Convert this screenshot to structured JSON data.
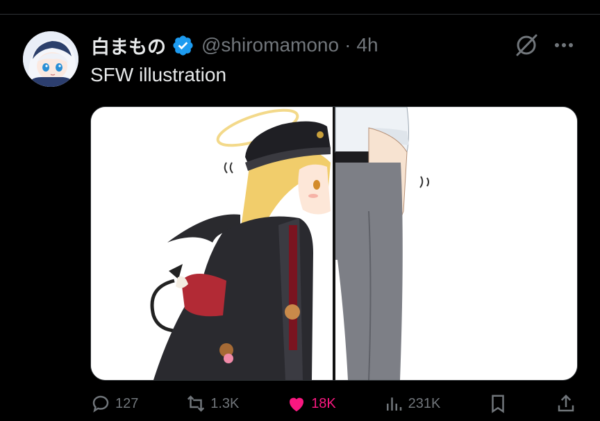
{
  "tweet": {
    "display_name": "白まもの",
    "handle": "@shiromamono",
    "separator": "·",
    "time": "4h",
    "text": "SFW illustration",
    "verified": true,
    "media_alt": "Anime illustration: a blonde girl with a halo, black peaked cap, black coat and small devil wings leans her forehead against the side of a tall person in a white shirt and grey trousers"
  },
  "actions": {
    "replies": "127",
    "reposts": "1.3K",
    "likes": "18K",
    "views": "231K"
  },
  "colors": {
    "background": "#000000",
    "text": "#e7e9ea",
    "muted": "#71767b",
    "verified": "#1d9bf0",
    "like": "#f91880"
  },
  "icons": [
    "verified-badge-icon",
    "grok-icon",
    "more-icon",
    "reply-icon",
    "repost-icon",
    "like-icon",
    "views-icon",
    "bookmark-icon",
    "share-icon"
  ]
}
